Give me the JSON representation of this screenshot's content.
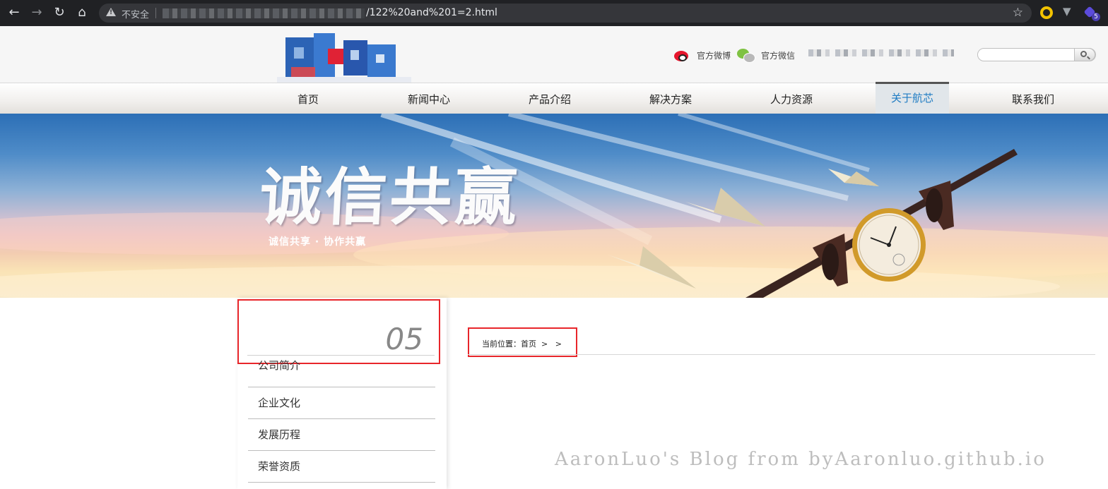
{
  "browser": {
    "insecure_label": "不安全",
    "url_visible": "/122%20and%201=2.html",
    "ext_badge": "5"
  },
  "header": {
    "weibo_label": "官方微博",
    "wechat_label": "官方微信",
    "search_placeholder": ""
  },
  "nav": {
    "items": [
      "首页",
      "新闻中心",
      "产品介绍",
      "解决方案",
      "人力资源",
      "关于航芯",
      "联系我们"
    ],
    "active_index": 5
  },
  "banner": {
    "title": "诚信共赢",
    "subtitle": "诚信共享 · 协作共赢"
  },
  "sidebar": {
    "number": "05",
    "items": [
      "公司简介",
      "企业文化",
      "发展历程",
      "荣誉资质"
    ]
  },
  "breadcrumb": {
    "text": "当前位置：首页  >   >"
  },
  "watermark": "AaronLuo's Blog from byAaronluo.github.io",
  "colors": {
    "highlight_box": "#e8262b",
    "active_nav_text": "#1f7cc3",
    "chrome_bg": "#202124"
  }
}
